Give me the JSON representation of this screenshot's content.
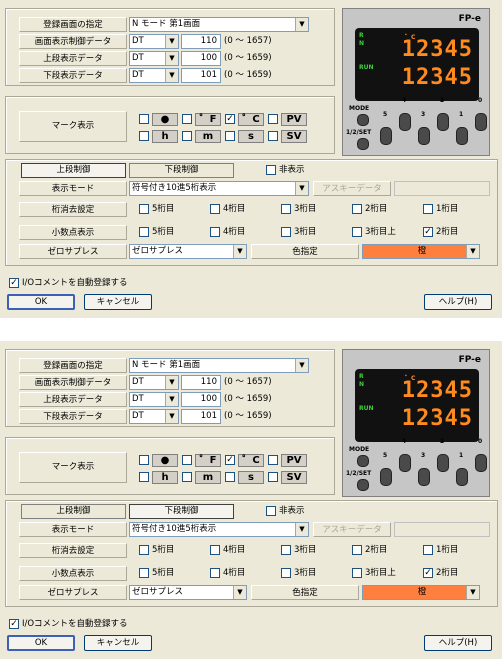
{
  "dialogs": [
    {
      "screen_spec": {
        "label": "登録画面の指定",
        "value": "N モード 第1画面"
      },
      "rows": [
        {
          "label": "画面表示制御データ",
          "type": "DT",
          "value": "110",
          "range": "(0 ～ 1657)"
        },
        {
          "label": "上段表示データ",
          "type": "DT",
          "value": "100",
          "range": "(0 ～ 1659)"
        },
        {
          "label": "下段表示データ",
          "type": "DT",
          "value": "101",
          "range": "(0 ～ 1659)"
        }
      ],
      "mark": {
        "label": "マーク表示",
        "items": [
          {
            "symbol": "●",
            "checked": false
          },
          {
            "symbol": "゜F",
            "checked": false
          },
          {
            "symbol": "゜C",
            "checked": true
          },
          {
            "symbol": "PV",
            "checked": false
          },
          {
            "symbol": "h",
            "checked": false
          },
          {
            "symbol": "m",
            "checked": false
          },
          {
            "symbol": "s",
            "checked": false
          },
          {
            "symbol": "SV",
            "checked": false
          }
        ]
      },
      "tabs": [
        "上段制御",
        "下段制御"
      ],
      "active_tab": 0,
      "hide": {
        "label": "非表示",
        "checked": false
      },
      "display_mode": {
        "label": "表示モード",
        "value": "符号付き10進5桁表示"
      },
      "ascii": {
        "label": "アスキーデータ",
        "value": ""
      },
      "digit_off": {
        "label": "桁消去設定",
        "options": [
          {
            "label": "5桁目",
            "checked": false
          },
          {
            "label": "4桁目",
            "checked": false
          },
          {
            "label": "3桁目",
            "checked": false
          },
          {
            "label": "2桁目",
            "checked": false
          },
          {
            "label": "1桁目",
            "checked": false
          }
        ]
      },
      "decimal": {
        "label": "小数点表示",
        "options": [
          {
            "label": "5桁目",
            "checked": false
          },
          {
            "label": "4桁目",
            "checked": false
          },
          {
            "label": "3桁目",
            "checked": false
          },
          {
            "label": "3桁目上",
            "checked": false
          },
          {
            "label": "2桁目",
            "checked": true
          }
        ]
      },
      "zero_sup": {
        "label": "ゼロサプレス",
        "value": "ゼロサプレス"
      },
      "color": {
        "label": "色指定",
        "value": "橙",
        "swatch": "#ff7f3f"
      },
      "auto_io": {
        "label": "I/Oコメントを自動登録する",
        "checked": true
      },
      "buttons": {
        "ok": "OK",
        "cancel": "キャンセル",
        "help": "ヘルプ(H)"
      },
      "device": {
        "brand": "FP-e",
        "upper": "12345",
        "lower": "12345",
        "n": "N",
        "run": "RUN",
        "r": "R",
        "c": "゜C",
        "mode": "MODE",
        "set": "1/2/SET",
        "keys": [
          "5",
          "4",
          "3",
          "2",
          "1",
          "0"
        ]
      }
    },
    {
      "screen_spec": {
        "label": "登録画面の指定",
        "value": "N モード 第1画面"
      },
      "rows": [
        {
          "label": "画面表示制御データ",
          "type": "DT",
          "value": "110",
          "range": "(0 ～ 1657)"
        },
        {
          "label": "上段表示データ",
          "type": "DT",
          "value": "100",
          "range": "(0 ～ 1659)"
        },
        {
          "label": "下段表示データ",
          "type": "DT",
          "value": "101",
          "range": "(0 ～ 1659)"
        }
      ],
      "mark": {
        "label": "マーク表示",
        "items": [
          {
            "symbol": "●",
            "checked": false
          },
          {
            "symbol": "゜F",
            "checked": false
          },
          {
            "symbol": "゜C",
            "checked": true
          },
          {
            "symbol": "PV",
            "checked": false
          },
          {
            "symbol": "h",
            "checked": false
          },
          {
            "symbol": "m",
            "checked": false
          },
          {
            "symbol": "s",
            "checked": false
          },
          {
            "symbol": "SV",
            "checked": false
          }
        ]
      },
      "tabs": [
        "上段制御",
        "下段制御"
      ],
      "active_tab": 1,
      "hide": {
        "label": "非表示",
        "checked": false
      },
      "display_mode": {
        "label": "表示モード",
        "value": "符号付き10進5桁表示"
      },
      "ascii": {
        "label": "アスキーデータ",
        "value": ""
      },
      "digit_off": {
        "label": "桁消去設定",
        "options": [
          {
            "label": "5桁目",
            "checked": false
          },
          {
            "label": "4桁目",
            "checked": false
          },
          {
            "label": "3桁目",
            "checked": false
          },
          {
            "label": "2桁目",
            "checked": false
          },
          {
            "label": "1桁目",
            "checked": false
          }
        ]
      },
      "decimal": {
        "label": "小数点表示",
        "options": [
          {
            "label": "5桁目",
            "checked": false
          },
          {
            "label": "4桁目",
            "checked": false
          },
          {
            "label": "3桁目",
            "checked": false
          },
          {
            "label": "3桁目上",
            "checked": false
          },
          {
            "label": "2桁目",
            "checked": true
          }
        ]
      },
      "zero_sup": {
        "label": "ゼロサプレス",
        "value": "ゼロサプレス"
      },
      "color": {
        "label": "色指定",
        "value": "橙",
        "swatch": "#ff7f3f"
      },
      "auto_io": {
        "label": "I/Oコメントを自動登録する",
        "checked": true
      },
      "buttons": {
        "ok": "OK",
        "cancel": "キャンセル",
        "help": "ヘルプ(H)"
      },
      "device": {
        "brand": "FP-e",
        "upper": "12345",
        "lower": "12345",
        "n": "N",
        "run": "RUN",
        "r": "R",
        "c": "゜C",
        "mode": "MODE",
        "set": "1/2/SET",
        "keys": [
          "5",
          "4",
          "3",
          "2",
          "1",
          "0"
        ]
      }
    }
  ]
}
